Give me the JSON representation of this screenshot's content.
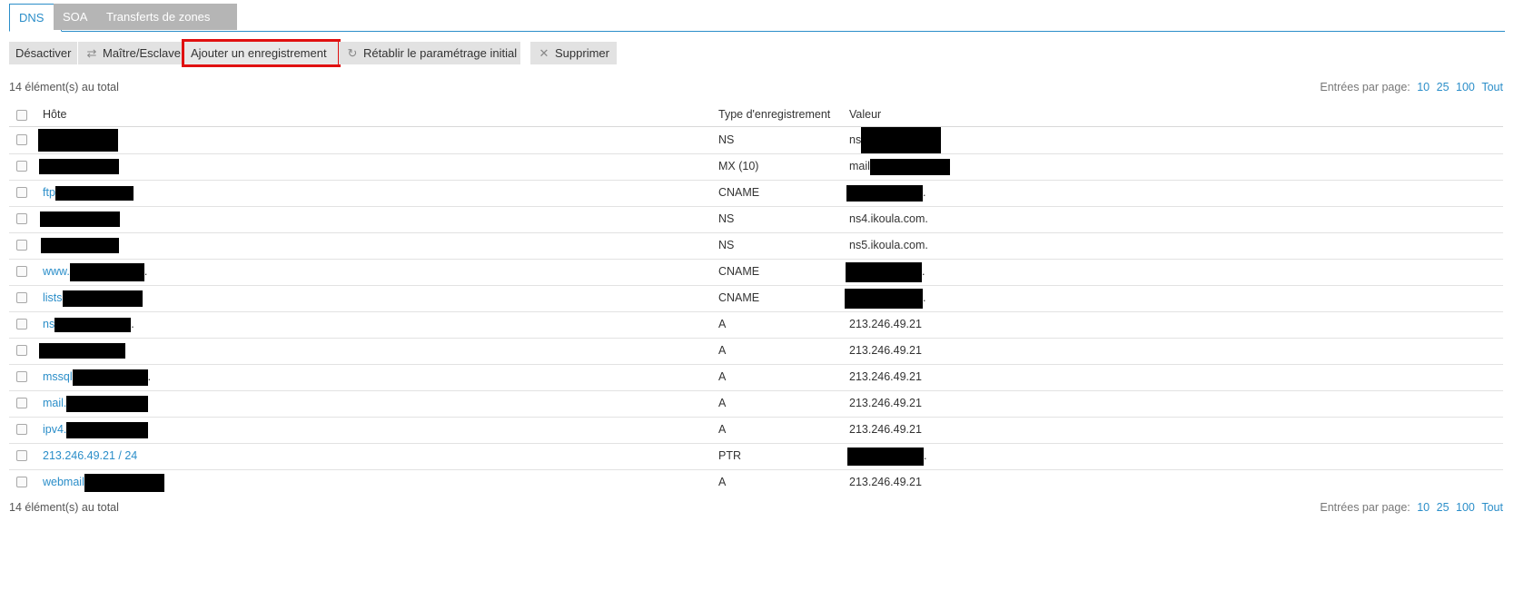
{
  "tabs": [
    "DNS",
    "SOA",
    "Transferts de zones"
  ],
  "toolbar": {
    "disable": "Désactiver",
    "master_slave": "Maître/Esclave",
    "add_record": "Ajouter un enregistrement",
    "reset": "Rétablir le paramétrage initial",
    "delete": "Supprimer"
  },
  "total_text": "14 élément(s) au total",
  "per_page": {
    "label": "Entrées par page:",
    "options": [
      "10",
      "25",
      "100",
      "Tout"
    ]
  },
  "columns": {
    "host": "Hôte",
    "type": "Type d'enregistrement",
    "value": "Valeur"
  },
  "rows": [
    {
      "host": "",
      "type": "NS",
      "value": "ns"
    },
    {
      "host": "",
      "type": "MX (10)",
      "value": "mail"
    },
    {
      "host": "ftp",
      "type": "CNAME",
      "value": "."
    },
    {
      "host": "",
      "type": "NS",
      "value": "ns4.ikoula.com."
    },
    {
      "host": "",
      "type": "NS",
      "value": "ns5.ikoula.com."
    },
    {
      "host": "www.",
      "type": "CNAME",
      "value": "."
    },
    {
      "host": "lists",
      "type": "CNAME",
      "value": "."
    },
    {
      "host": "ns",
      "type": "A",
      "value": "213.246.49.21"
    },
    {
      "host": "",
      "type": "A",
      "value": "213.246.49.21"
    },
    {
      "host": "mssql",
      "type": "A",
      "value": "213.246.49.21"
    },
    {
      "host": "mail.",
      "type": "A",
      "value": "213.246.49.21"
    },
    {
      "host": "ipv4.",
      "type": "A",
      "value": "213.246.49.21"
    },
    {
      "host": "213.246.49.21 / 24",
      "type": "PTR",
      "value": "."
    },
    {
      "host": "webmail",
      "type": "A",
      "value": "213.246.49.21"
    }
  ]
}
